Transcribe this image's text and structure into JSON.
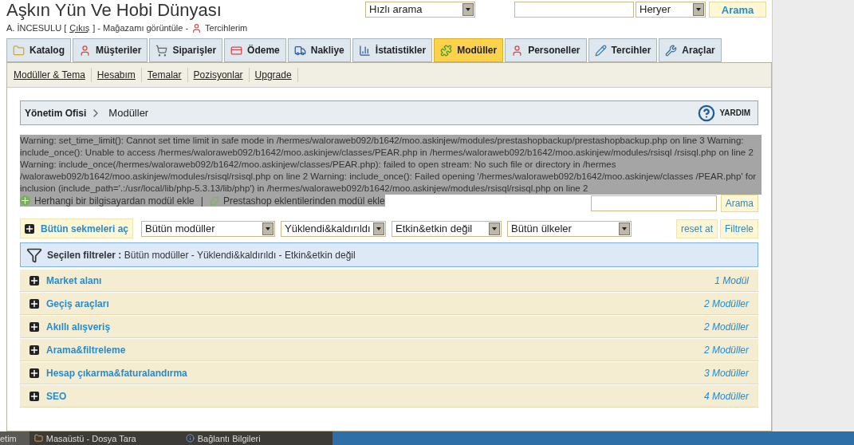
{
  "header": {
    "shop_title": "Aşkın Yün Ve Hobi Dünyası",
    "quick_search": "Hızlı arama",
    "search_scope": "Heryer",
    "search_button": "Arama",
    "user": "A. İNCESULU [",
    "logout": "Çıkış",
    "user_rest": "] - Mağazamı görüntüle -",
    "preferences": "Tercihlerim"
  },
  "tabs": [
    {
      "label": "Katalog",
      "selected": false
    },
    {
      "label": "Müşteriler",
      "selected": false
    },
    {
      "label": "Siparişler",
      "selected": false
    },
    {
      "label": "Ödeme",
      "selected": false
    },
    {
      "label": "Nakliye",
      "selected": false
    },
    {
      "label": "İstatistikler",
      "selected": false
    },
    {
      "label": "Modüller",
      "selected": true
    },
    {
      "label": "Personeller",
      "selected": false
    },
    {
      "label": "Tercihler",
      "selected": false
    },
    {
      "label": "Araçlar",
      "selected": false
    }
  ],
  "subnav": [
    "Modüller & Tema",
    "Hesabım",
    "Temalar",
    "Pozisyonlar",
    "Upgrade"
  ],
  "breadcrumb": {
    "root": "Yönetim Ofisi",
    "current": "Modüller",
    "help": "YARDIM"
  },
  "warning": "Warning: set_time_limit(): Cannot set time limit in safe mode in /hermes/waloraweb092/b1642/moo.askinjew/modules/prestashopbackup/prestashopbackup.php on line 3 Warning: include_once(): Unable to access /hermes/waloraweb092/b1642/moo.askinjew/classes/PEAR.php in /hermes/waloraweb092/b1642/moo.askinjew/modules/rsisql /rsisql.php on line 2 Warning: include_once(/hermes/waloraweb092/b1642/moo.askinjew/classes/PEAR.php): failed to open stream: No such file or directory in /hermes /waloraweb092/b1642/moo.askinjew/modules/rsisql/rsisql.php on line 2 Warning: include_once(): Failed opening '/hermes/waloraweb092/b1642/moo.askinjew/classes /PEAR.php' for inclusion (include_path='.:/usr/local/lib/php-5.3.13/lib/php') in /hermes/waloraweb092/b1642/moo.askinjew/modules/rsisql/rsisql.php on line 2",
  "add_local": "Herhangi bir bilgisayardan modül ekle",
  "separator": "|",
  "add_addons": "Prestashop eklentilerinden modül ekle",
  "module_search_button": "Arama",
  "filters": {
    "expand_all": "Bütün sekmeleri aç",
    "selects": [
      "Bütün modüller",
      "Yüklendi&kaldırıldı",
      "Etkin&etkin değil",
      "Bütün ülkeler"
    ],
    "reset": "reset at",
    "apply": "Filtrele"
  },
  "selected_filters": {
    "label": "Seçilen filtreler :",
    "value": "Bütün modüller - Yüklendi&kaldırıldı - Etkin&etkin değil"
  },
  "categories": [
    {
      "name": "Market alanı",
      "count": "1 Modül",
      "expanded": false
    },
    {
      "name": "Geçiş araçları",
      "count": "2 Modüller",
      "expanded": false
    },
    {
      "name": "Akıllı alışveriş",
      "count": "2 Modüller",
      "expanded": false
    },
    {
      "name": "Arama&filtreleme",
      "count": "2 Modüller",
      "expanded": false
    },
    {
      "name": "Hesap çıkarma&faturalandırma",
      "count": "3 Modüller",
      "expanded": false
    },
    {
      "name": "SEO",
      "count": "4 Modüller",
      "expanded": false
    }
  ],
  "taskbar": [
    "etim",
    "Masaüstü - Dosya Tara",
    "Bağlantı Bilgileri"
  ]
}
